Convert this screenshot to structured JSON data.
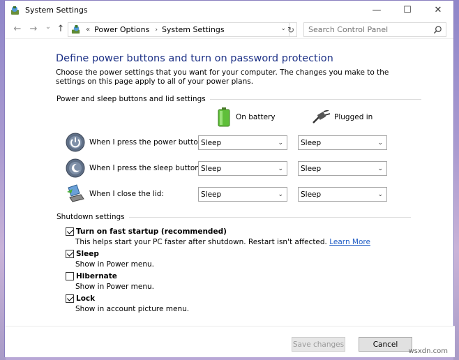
{
  "window": {
    "title": "System Settings",
    "controls": [
      "—",
      "☐",
      "✕"
    ]
  },
  "nav": {
    "back": "←",
    "forward": "→",
    "recent": "⌄",
    "up": "↑",
    "breadcrumbs_prefix": "«",
    "breadcrumbs": [
      "Power Options",
      "System Settings"
    ],
    "refresh": "↻",
    "search_placeholder": "Search Control Panel"
  },
  "main": {
    "heading": "Define power buttons and turn on password protection",
    "description": "Choose the power settings that you want for your computer. The changes you make to the settings on this page apply to all of your power plans.",
    "power_group_title": "Power and sleep buttons and lid settings",
    "col_battery": "On battery",
    "col_plugged": "Plugged in",
    "rows": [
      {
        "label": "When I press the power button:",
        "battery": "Sleep",
        "plugged": "Sleep"
      },
      {
        "label": "When I press the sleep button:",
        "battery": "Sleep",
        "plugged": "Sleep"
      },
      {
        "label": "When I close the lid:",
        "battery": "Sleep",
        "plugged": "Sleep"
      }
    ],
    "shutdown_group_title": "Shutdown settings",
    "shutdown": [
      {
        "label": "Turn on fast startup (recommended)",
        "sub": "This helps start your PC faster after shutdown. Restart isn't affected.",
        "link": "Learn More",
        "checked": true
      },
      {
        "label": "Sleep",
        "sub": "Show in Power menu.",
        "checked": true
      },
      {
        "label": "Hibernate",
        "sub": "Show in Power menu.",
        "checked": false
      },
      {
        "label": "Lock",
        "sub": "Show in account picture menu.",
        "checked": true
      }
    ]
  },
  "footer": {
    "save_label": "Save changes",
    "cancel_label": "Cancel"
  },
  "watermark": "wsxdn.com",
  "colors": {
    "heading": "#1e3287",
    "link": "#1f5cc4",
    "desktop": "#b8a7d6"
  }
}
